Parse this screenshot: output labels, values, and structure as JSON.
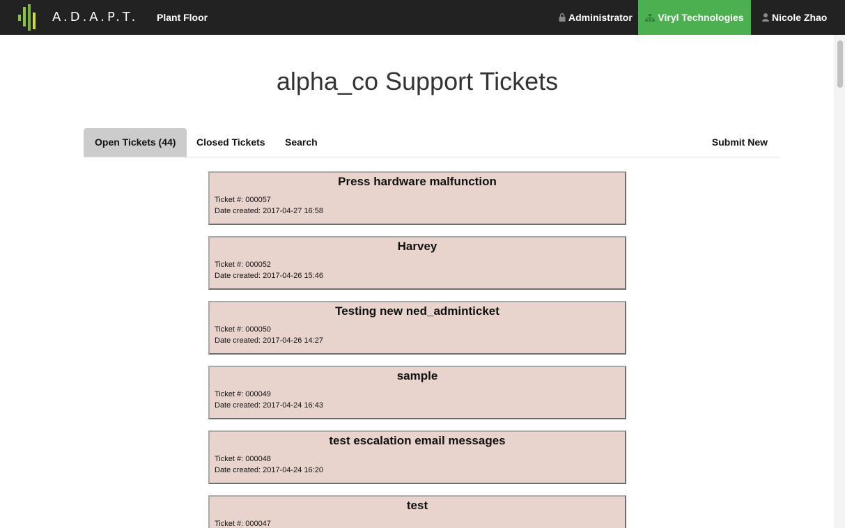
{
  "navbar": {
    "brand": "A.D.A.P.T.",
    "plant_floor": "Plant Floor",
    "administrator": "Administrator",
    "company": "Viryl Technologies",
    "user": "Nicole Zhao",
    "company_bg": "#4caf50"
  },
  "page": {
    "title": "alpha_co Support Tickets"
  },
  "tabs": {
    "open": "Open Tickets (44)",
    "closed": "Closed Tickets",
    "search": "Search",
    "submit": "Submit New"
  },
  "labels": {
    "ticket_num": "Ticket #: ",
    "date_created": "Date created: "
  },
  "tickets": [
    {
      "title": "Press hardware malfunction",
      "number": "000057",
      "date": "2017-04-27 16:58"
    },
    {
      "title": "Harvey",
      "number": "000052",
      "date": "2017-04-26 15:46"
    },
    {
      "title": "Testing new ned_adminticket",
      "number": "000050",
      "date": "2017-04-26 14:27"
    },
    {
      "title": "sample",
      "number": "000049",
      "date": "2017-04-24 16:43"
    },
    {
      "title": "test escalation email messages",
      "number": "000048",
      "date": "2017-04-24 16:20"
    },
    {
      "title": "test",
      "number": "000047",
      "date": ""
    }
  ]
}
